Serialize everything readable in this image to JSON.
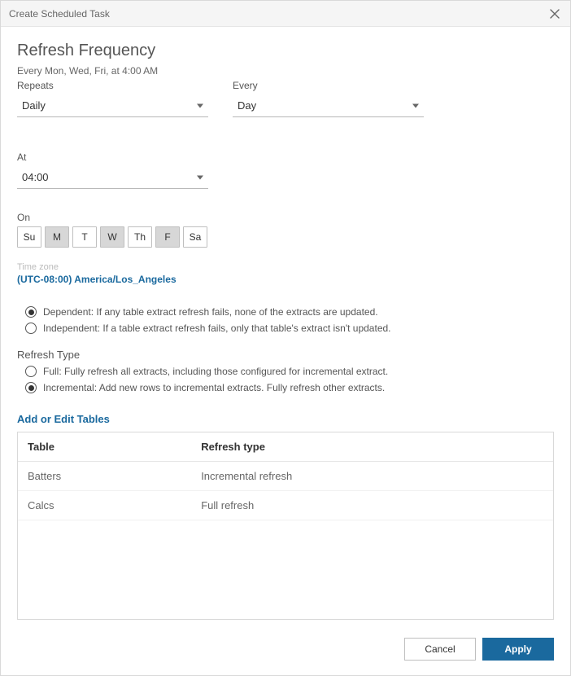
{
  "header": {
    "title": "Create Scheduled Task"
  },
  "frequency": {
    "heading": "Refresh Frequency",
    "summary": "Every Mon, Wed, Fri, at 4:00 AM",
    "repeats_label": "Repeats",
    "repeats_value": "Daily",
    "every_label": "Every",
    "every_value": "Day",
    "at_label": "At",
    "at_value": "04:00",
    "on_label": "On",
    "days": [
      {
        "abbr": "Su",
        "selected": false
      },
      {
        "abbr": "M",
        "selected": true
      },
      {
        "abbr": "T",
        "selected": false
      },
      {
        "abbr": "W",
        "selected": true
      },
      {
        "abbr": "Th",
        "selected": false
      },
      {
        "abbr": "F",
        "selected": true
      },
      {
        "abbr": "Sa",
        "selected": false
      }
    ],
    "timezone_label": "Time zone",
    "timezone_value": "(UTC-08:00) America/Los_Angeles"
  },
  "dependency": {
    "dependent_label": "Dependent: If any table extract refresh fails, none of the extracts are updated.",
    "independent_label": "Independent: If a table extract refresh fails, only that table's extract isn't updated.",
    "selected": "dependent"
  },
  "refresh_type": {
    "heading": "Refresh Type",
    "full_label": "Full: Fully refresh all extracts, including those configured for incremental extract.",
    "incremental_label": "Incremental: Add new rows to incremental extracts. Fully refresh other extracts.",
    "selected": "incremental"
  },
  "tables": {
    "edit_link": "Add or Edit Tables",
    "columns": {
      "table": "Table",
      "refresh_type": "Refresh type"
    },
    "rows": [
      {
        "table": "Batters",
        "refresh_type": "Incremental refresh"
      },
      {
        "table": "Calcs",
        "refresh_type": "Full refresh"
      }
    ]
  },
  "footer": {
    "cancel": "Cancel",
    "apply": "Apply"
  }
}
